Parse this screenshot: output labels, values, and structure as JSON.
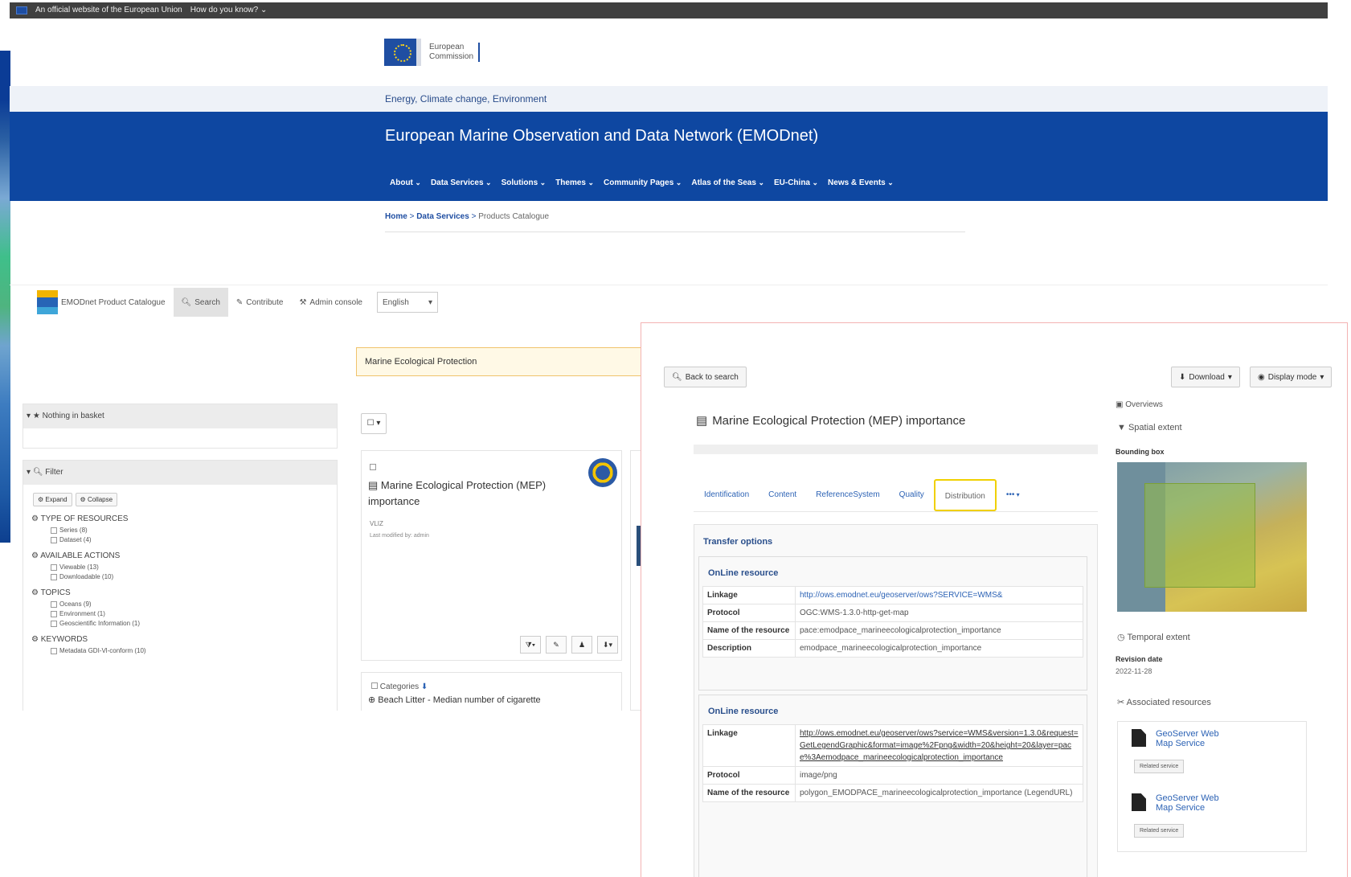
{
  "eu_bar": {
    "official_text": "An official website of the European Union",
    "how_text": "How do you know? ⌄"
  },
  "header": {
    "logo_text_1": "European",
    "logo_text_2": "Commission",
    "topic": "Energy, Climate change, Environment",
    "site_title": "European Marine Observation and Data Network (EMODnet)",
    "nav": [
      "About",
      "Data Services",
      "Solutions",
      "Themes",
      "Community Pages",
      "Atlas of the Seas",
      "EU-China",
      "News & Events"
    ],
    "breadcrumb": {
      "home": "Home",
      "sep1": " > ",
      "data_services": "Data Services",
      "sep2": " > ",
      "current": "Products Catalogue"
    }
  },
  "catalog_bar": {
    "brand": "EMODnet Product Catalogue",
    "search": "Search",
    "contribute": "Contribute",
    "admin": "Admin console",
    "language": "English"
  },
  "search": {
    "value": "Marine Ecological Protection"
  },
  "sidebar": {
    "basket": "Nothing in basket",
    "filter": "Filter",
    "expand": "Expand",
    "collapse": "Collapse",
    "facets": [
      {
        "title": "TYPE OF RESOURCES",
        "options": [
          "Series (8)",
          "Dataset (4)"
        ]
      },
      {
        "title": "AVAILABLE ACTIONS",
        "options": [
          "Viewable (13)",
          "Downloadable (10)"
        ]
      },
      {
        "title": "TOPICS",
        "options": [
          "Oceans (9)",
          "Environment (1)",
          "Geoscientific Information (1)"
        ]
      },
      {
        "title": "KEYWORDS",
        "options": [
          "Metadata GDI-Vl-conform (10)"
        ]
      }
    ]
  },
  "results": {
    "sort": "☐ ▾",
    "card1": {
      "title": "Marine Ecological Protection (MEP) importance",
      "meta1": "VLIZ",
      "meta2": "Last modified by: admin"
    },
    "card2": {
      "category": "Categories",
      "title": "Beach Litter - Median number of cigarette"
    }
  },
  "detail": {
    "back": "Back to search",
    "download": "Download",
    "display_mode": "Display mode",
    "title": "Marine Ecological Protection (MEP) importance",
    "tabs": [
      "Identification",
      "Content",
      "ReferenceSystem",
      "Quality",
      "Distribution",
      "•••"
    ],
    "transfer_options": "Transfer options",
    "resources": [
      {
        "heading": "OnLine resource",
        "rows": [
          {
            "k": "Linkage",
            "v": "http://ows.emodnet.eu/geoserver/ows?SERVICE=WMS&"
          },
          {
            "k": "Protocol",
            "v": "OGC:WMS-1.3.0-http-get-map"
          },
          {
            "k": "Name of the resource",
            "v": "pace:emodpace_marineecologicalprotection_importance"
          },
          {
            "k": "Description",
            "v": "emodpace_marineecologicalprotection_importance"
          }
        ]
      },
      {
        "heading": "OnLine resource",
        "rows": [
          {
            "k": "Linkage",
            "v": "http://ows.emodnet.eu/geoserver/ows?service=WMS&version=1.3.0&request=GetLegendGraphic&format=image%2Fpng&width=20&height=20&layer=pace%3Aemodpace_marineecologicalprotection_importance"
          },
          {
            "k": "Protocol",
            "v": "image/png"
          },
          {
            "k": "Name of the resource",
            "v": "polygon_EMODPACE_marineecologicalprotection_importance (LegendURL)"
          }
        ]
      }
    ],
    "right": {
      "overviews": "Overviews",
      "spatial_extent": "Spatial extent",
      "bounding_box": "Bounding box",
      "temporal_extent": "Temporal extent",
      "revision_label": "Revision date",
      "revision_value": "2022-11-28",
      "associated": "Associated resources",
      "assoc_items": [
        {
          "label": "GeoServer Web Map Service",
          "button": "Related service"
        },
        {
          "label": "GeoServer Web Map Service",
          "button": "Related service"
        }
      ]
    }
  }
}
